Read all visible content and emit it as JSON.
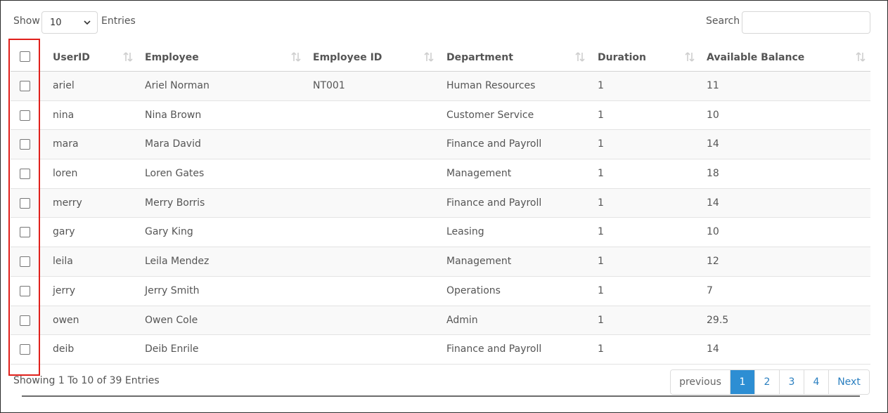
{
  "controls": {
    "show_label": "Show",
    "entries_value": "10",
    "entries_label": "Entries",
    "search_label": "Search",
    "search_value": ""
  },
  "table": {
    "headers": [
      "UserID",
      "Employee",
      "Employee ID",
      "Department",
      "Duration",
      "Available Balance"
    ],
    "rows": [
      {
        "user_id": "ariel",
        "employee": "Ariel Norman",
        "employee_id": "NT001",
        "department": "Human Resources",
        "duration": "1",
        "balance": "11"
      },
      {
        "user_id": "nina",
        "employee": "Nina Brown",
        "employee_id": "",
        "department": "Customer Service",
        "duration": "1",
        "balance": "10"
      },
      {
        "user_id": "mara",
        "employee": "Mara David",
        "employee_id": "",
        "department": "Finance and Payroll",
        "duration": "1",
        "balance": "14"
      },
      {
        "user_id": "loren",
        "employee": "Loren Gates",
        "employee_id": "",
        "department": "Management",
        "duration": "1",
        "balance": "18"
      },
      {
        "user_id": "merry",
        "employee": "Merry Borris",
        "employee_id": "",
        "department": "Finance and Payroll",
        "duration": "1",
        "balance": "14"
      },
      {
        "user_id": "gary",
        "employee": "Gary King",
        "employee_id": "",
        "department": "Leasing",
        "duration": "1",
        "balance": "10"
      },
      {
        "user_id": "leila",
        "employee": "Leila Mendez",
        "employee_id": "",
        "department": "Management",
        "duration": "1",
        "balance": "12"
      },
      {
        "user_id": "jerry",
        "employee": "Jerry Smith",
        "employee_id": "",
        "department": "Operations",
        "duration": "1",
        "balance": "7"
      },
      {
        "user_id": "owen",
        "employee": "Owen Cole",
        "employee_id": "",
        "department": "Admin",
        "duration": "1",
        "balance": "29.5"
      },
      {
        "user_id": "deib",
        "employee": "Deib Enrile",
        "employee_id": "",
        "department": "Finance and Payroll",
        "duration": "1",
        "balance": "14"
      }
    ]
  },
  "footer": {
    "info": "Showing 1 To 10 of 39 Entries",
    "previous_label": "previous",
    "pages": [
      "1",
      "2",
      "3",
      "4"
    ],
    "active_page": "1",
    "next_label": "Next"
  },
  "colors": {
    "highlight": "#e0201b",
    "active_page": "#2d8ed3",
    "link": "#2a7fc0"
  }
}
